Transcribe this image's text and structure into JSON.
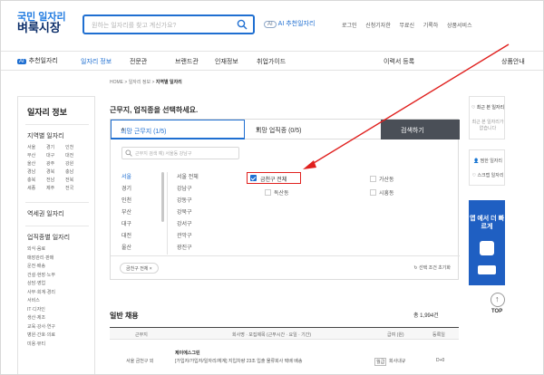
{
  "header": {
    "logo_line1": "국민 일자리",
    "logo_line2": "벼룩시장",
    "search_placeholder": "원하는 일자리를 찾고 계신가요?",
    "ai_pill": "AI",
    "ai_label": "AI 추천일자리",
    "top_links": [
      "로그인",
      "신청기자한",
      "무료신",
      "기록하",
      "상품서비스"
    ]
  },
  "nav": {
    "ai_box": "AI",
    "ai_label": "추천일자리",
    "items": [
      "일자리 정보",
      "전문관",
      "브랜드관",
      "인재정보",
      "취업가이드"
    ],
    "right_items": [
      "이력서 등록",
      "상품안내"
    ]
  },
  "breadcrumb": {
    "path": "HOME > 일자리 정보 > ",
    "current": "지역별 일자리"
  },
  "left": {
    "title": "일자리 정보",
    "region_title": "지역별 일자리",
    "regions": [
      "서울",
      "경기",
      "인천",
      "부산",
      "대구",
      "대전",
      "울산",
      "광주",
      "강원",
      "경남",
      "경북",
      "충남",
      "충북",
      "전남",
      "전북",
      "세종",
      "제주",
      "전국"
    ],
    "station_title": "역세권 일자리",
    "job_title": "업직종별 일자리",
    "jobs": [
      "외식·음료",
      "매장관리·판매",
      "운전·배송",
      "건설·현장·노무",
      "상담·영업",
      "사무·회계·경리",
      "서비스",
      "IT·디자인",
      "생산·제조",
      "교육·강사·연구",
      "병원·간호·의료",
      "미용·뷰티"
    ]
  },
  "main": {
    "title": "근무지, 업직종을 선택하세요.",
    "tab_region": "희망 근무지 (1/5)",
    "tab_job": "희망 업직종 (0/5)",
    "tab_search": "검색하기",
    "inner_search_placeholder": "근무지 검색 예) 서울동 강남구",
    "cities": [
      "서울",
      "경기",
      "인천",
      "부산",
      "대구",
      "대전",
      "울산"
    ],
    "districts": [
      "서울 전체",
      "강남구",
      "강동구",
      "강북구",
      "강서구",
      "관악구",
      "광진구"
    ],
    "checked_label": "금천구 전체",
    "options": [
      "가산동",
      "독산동",
      "시흥동"
    ],
    "chip": "금천구 전체",
    "reset": "선택 조건 초기화"
  },
  "results": {
    "title": "일반 채용",
    "count": "총 1,994건",
    "columns": [
      "근무지",
      "회사명 · 모집제목 (근무시간 · 요일 · 기간)",
      "급여 (원)",
      "등록일"
    ],
    "row_region": "서울 금천구 외",
    "row_company": "제이에스그린",
    "row_desc": "[가입자/가입자/일자리/체계] 지입차량 23조 입출 물류회사 택배 배송",
    "row_pay_label": "월급",
    "row_pay": "회사내규",
    "row_date": "D+0"
  },
  "right": {
    "recent_title": "최근 본 일자리",
    "recent_empty": "최근 본 일자리가 없습니다",
    "scrap": "찜한 일자리",
    "scrap2": "스크랩 일자리",
    "banner_text": "앱 에서 더 빠르게",
    "top": "TOP"
  },
  "colors": {
    "accent": "#1f6fd1",
    "annotation": "#e0201e",
    "search_button": "#4a4f57",
    "banner": "#1f5fc2"
  }
}
